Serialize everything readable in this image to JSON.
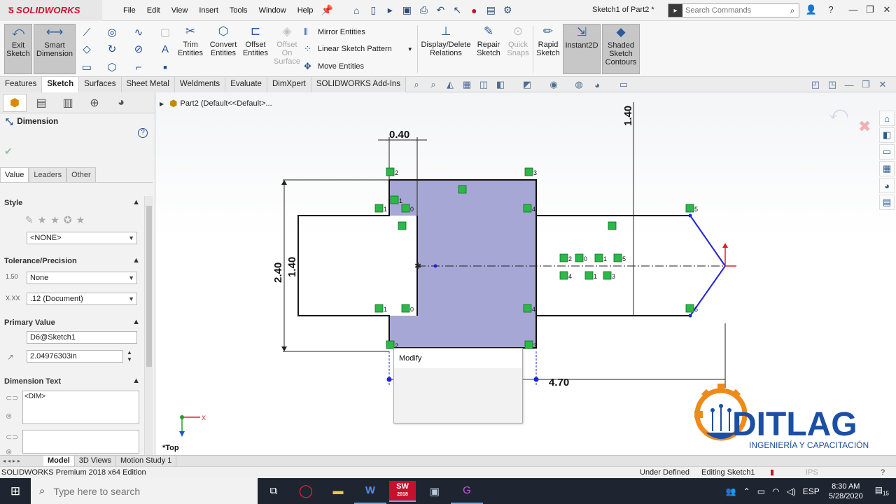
{
  "app": {
    "brand": "SOLIDWORKS",
    "document_title": "Sketch1 of Part2 *",
    "search_placeholder": "Search Commands"
  },
  "menu": [
    "File",
    "Edit",
    "View",
    "Insert",
    "Tools",
    "Window",
    "Help"
  ],
  "commands": {
    "exit_sketch": "Exit Sketch",
    "smart_dimension": "Smart Dimension",
    "trim_entities": "Trim Entities",
    "convert_entities": "Convert Entities",
    "offset_entities": "Offset Entities",
    "offset_on_surface": "Offset On Surface",
    "mirror_entities": "Mirror Entities",
    "linear_sketch_pattern": "Linear Sketch Pattern",
    "move_entities": "Move Entities",
    "display_delete_relations": "Display/Delete Relations",
    "repair_sketch": "Repair Sketch",
    "quick_snaps": "Quick Snaps",
    "rapid_sketch": "Rapid Sketch",
    "instant2d": "Instant2D",
    "shaded_sketch_contours": "Shaded Sketch Contours"
  },
  "cm_tabs": [
    "Features",
    "Sketch",
    "Surfaces",
    "Sheet Metal",
    "Weldments",
    "Evaluate",
    "DimXpert",
    "SOLIDWORKS Add-Ins"
  ],
  "cm_active_tab": "Sketch",
  "property_manager": {
    "title": "Dimension",
    "subtabs": [
      "Value",
      "Leaders",
      "Other"
    ],
    "style_label": "Style",
    "style_value": "<NONE>",
    "tolerance_label": "Tolerance/Precision",
    "tolerance_value": "None",
    "precision_value": ".12 (Document)",
    "tol_icon_text": "1.50",
    "prec_icon_text": "X.XX",
    "primary_value_label": "Primary Value",
    "dim_name": "D6@Sketch1",
    "dim_value": "2.04976303in",
    "dimension_text_label": "Dimension Text",
    "dim_text": "<DIM>"
  },
  "tree": {
    "part": "Part2  (Default<<Default>..."
  },
  "sketch": {
    "dim_top_width": "0.40",
    "dim_right_vertical": "1.40",
    "dim_overall_height": "2.40",
    "dim_inner_height": "1.40",
    "dim_length": "4.70",
    "relation_labels": [
      "2",
      "3",
      "1",
      "0",
      "4",
      "1",
      "1",
      "0",
      "4",
      "2",
      "3",
      "5",
      "5",
      "2",
      "0",
      "1",
      "5",
      "4",
      "1",
      "3"
    ]
  },
  "modify_dialog": {
    "title": "Modify"
  },
  "view_name": "*Top",
  "bottom_tabs": [
    "Model",
    "3D Views",
    "Motion Study 1"
  ],
  "bottom_active": "Model",
  "status": {
    "edition": "SOLIDWORKS Premium 2018 x64 Edition",
    "state": "Under Defined",
    "editing": "Editing Sketch1",
    "units": "IPS"
  },
  "watermark": {
    "name": "DITLAG",
    "tagline": "INGENIERÍA Y CAPACITACIÓN"
  },
  "taskbar": {
    "search_placeholder": "Type here to search",
    "language": "ESP",
    "time": "8:30 AM",
    "date": "5/28/2020",
    "notif_count": "15",
    "sw_badge": "2018"
  },
  "colors": {
    "sketch_fill": "#a7a7d6",
    "sketch_line": "#111111",
    "construction": "#1e24d6",
    "relation_green": "#2db84a",
    "brand_red": "#c8102e",
    "watermark_blue": "#1b4fa3",
    "watermark_orange": "#ee8a1a"
  }
}
